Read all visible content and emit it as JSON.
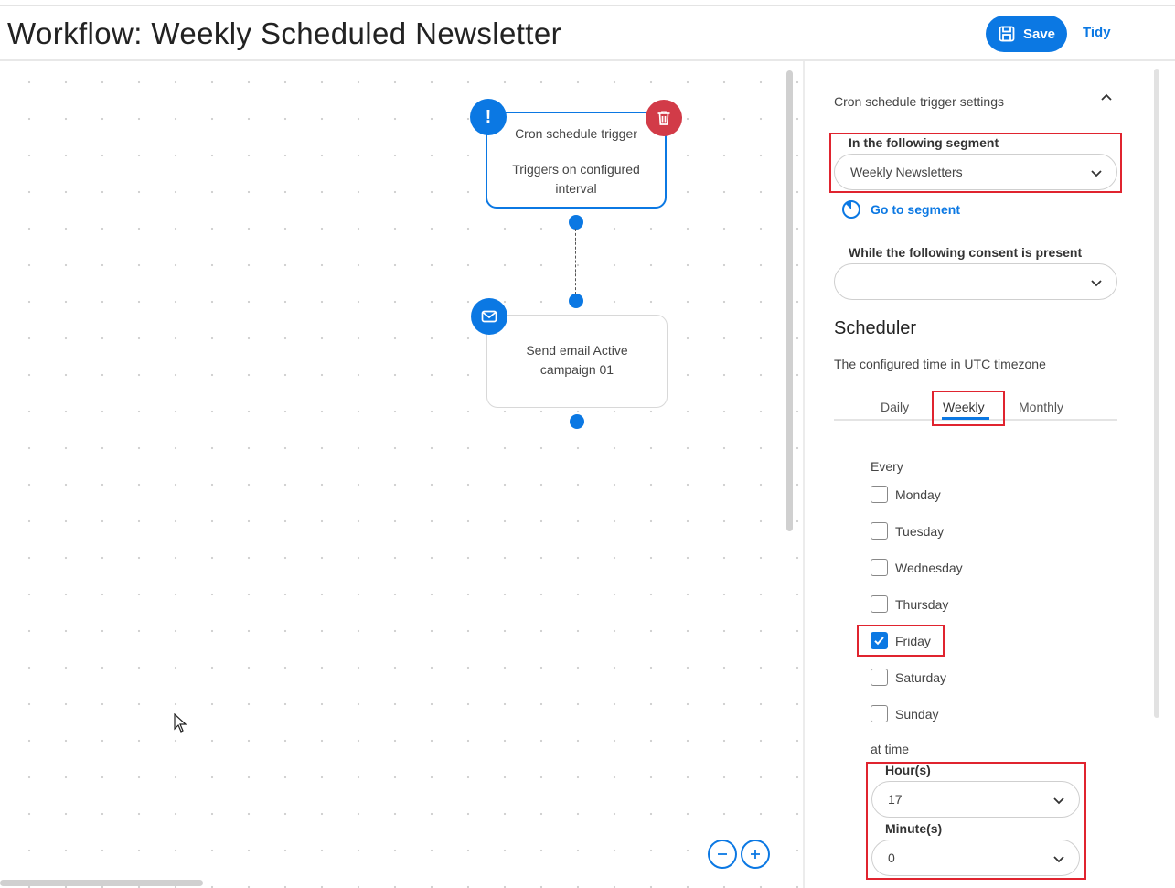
{
  "header": {
    "title": "Workflow: Weekly Scheduled Newsletter",
    "save_label": "Save",
    "tidy_label": "Tidy"
  },
  "canvas": {
    "trigger_node": {
      "title": "Cron schedule trigger",
      "subtitle": "Triggers on configured interval",
      "warning_glyph": "!"
    },
    "email_node": {
      "label": "Send email Active campaign 01"
    },
    "icons": [
      "warning-icon",
      "trash-icon",
      "mail-icon",
      "zoom-out-icon",
      "zoom-in-icon"
    ]
  },
  "panel": {
    "section_title": "Cron schedule trigger settings",
    "segment": {
      "label": "In the following segment",
      "value": "Weekly Newsletters"
    },
    "goto_segment_label": "Go to segment",
    "consent": {
      "label": "While the following consent is present",
      "value": ""
    },
    "scheduler": {
      "title": "Scheduler",
      "subtitle": "The configured time in UTC timezone",
      "tabs": [
        {
          "label": "Daily",
          "active": false
        },
        {
          "label": "Weekly",
          "active": true
        },
        {
          "label": "Monthly",
          "active": false
        }
      ],
      "every_label": "Every",
      "days": [
        {
          "label": "Monday",
          "checked": false
        },
        {
          "label": "Tuesday",
          "checked": false
        },
        {
          "label": "Wednesday",
          "checked": false
        },
        {
          "label": "Thursday",
          "checked": false
        },
        {
          "label": "Friday",
          "checked": true
        },
        {
          "label": "Saturday",
          "checked": false
        },
        {
          "label": "Sunday",
          "checked": false
        }
      ],
      "at_time_label": "at time",
      "hours": {
        "label": "Hour(s)",
        "value": "17"
      },
      "minutes": {
        "label": "Minute(s)",
        "value": "0"
      }
    }
  },
  "colors": {
    "accent": "#0b78e3",
    "danger": "#d23b48",
    "highlight": "#e0242f"
  }
}
